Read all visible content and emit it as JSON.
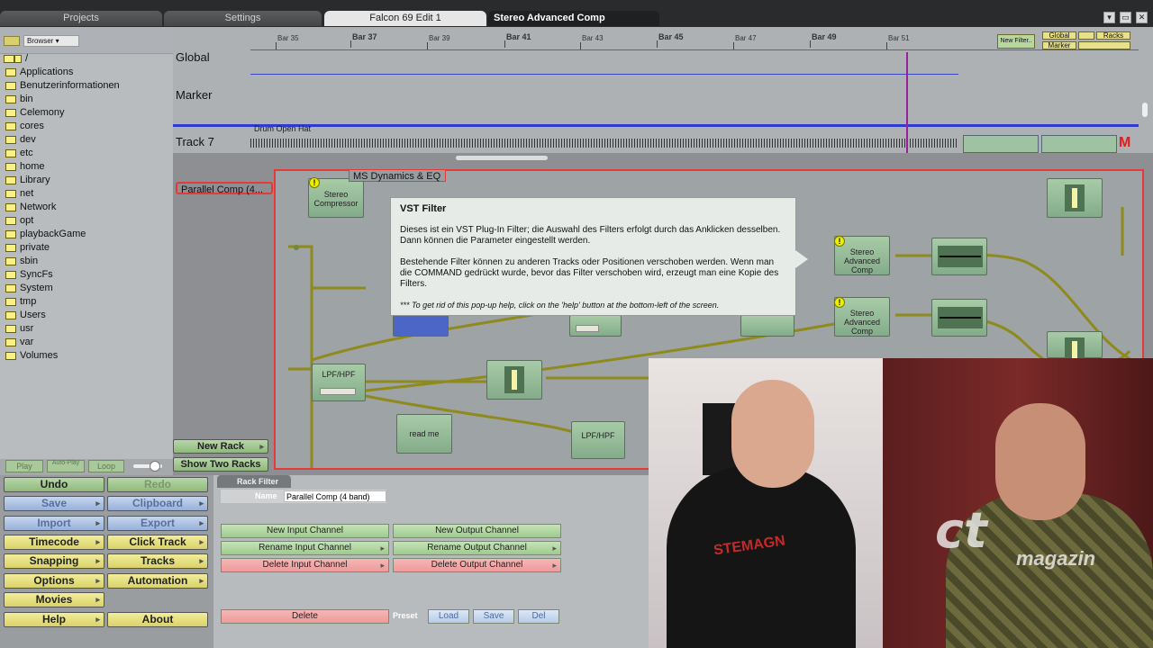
{
  "tabs": [
    {
      "label": "Projects"
    },
    {
      "label": "Settings"
    },
    {
      "label": "Falcon 69 Edit 1"
    },
    {
      "label": "Stereo Advanced Comp"
    }
  ],
  "browser": {
    "selector": "Browser",
    "path": "/",
    "items": [
      "Applications",
      "Benutzerinformationen",
      "bin",
      "Celemony",
      "cores",
      "dev",
      "etc",
      "home",
      "Library",
      "net",
      "Network",
      "opt",
      "playbackGame",
      "private",
      "sbin",
      "SyncFs",
      "System",
      "tmp",
      "Users",
      "usr",
      "var",
      "Volumes"
    ]
  },
  "transport": {
    "play": "Play",
    "autoplay": "Auto-Play",
    "loop": "Loop"
  },
  "timeline": {
    "ticks": [
      "Bar 35",
      "Bar 37",
      "Bar 39",
      "Bar 41",
      "Bar 43",
      "Bar 45",
      "Bar 47",
      "Bar 49",
      "Bar 51"
    ],
    "global": "Global",
    "marker": "Marker",
    "clip": "Drum Open Hat",
    "track": "Track 7",
    "new_filter": "New Filter..",
    "global_btn": "Global",
    "racks_btn": "Racks",
    "marker_btn": "Marker",
    "mute": "M"
  },
  "racks": {
    "list": [
      "MS Dynamics & EQ",
      "Parallel Comp (4..."
    ],
    "new_rack": "New Rack",
    "show_two": "Show Two Racks",
    "nodes": {
      "stereo_comp": "Stereo Compressor",
      "lpf1": "LPF/HPF",
      "lpf2": "LPF/HPF",
      "readme": "read me",
      "adv1": "Stereo Advanced Comp",
      "adv2": "Stereo Advanced Comp"
    }
  },
  "tooltip": {
    "title": "VST Filter",
    "p1": "Dieses ist ein VST Plug-In Filter; die Auswahl des Filters erfolgt durch das Anklicken desselben. Dann können die Parameter eingestellt werden.",
    "p2": "Bestehende Filter können zu anderen Tracks oder Positionen verschoben werden. Wenn man die COMMAND gedrückt wurde, bevor das Filter verschoben wird, erzeugt man eine Kopie des Filters.",
    "note": "*** To get rid of this pop-up help, click on the 'help' button at the bottom-left of the screen."
  },
  "buttons": {
    "undo": "Undo",
    "redo": "Redo",
    "save": "Save",
    "clipboard": "Clipboard",
    "import": "Import",
    "export": "Export",
    "timecode": "Timecode",
    "click_track": "Click Track",
    "snapping": "Snapping",
    "tracks": "Tracks",
    "options": "Options",
    "automation": "Automation",
    "movies": "Movies",
    "help": "Help",
    "about": "About"
  },
  "rack_filter": {
    "tab": "Rack Filter",
    "name_label": "Name",
    "name_value": "Parallel Comp (4 band)",
    "new_input": "New Input Channel",
    "new_output": "New Output Channel",
    "rename_input": "Rename Input Channel",
    "rename_output": "Rename Output Channel",
    "delete_input": "Delete Input Channel",
    "delete_output": "Delete Output Channel",
    "delete": "Delete",
    "preset": "Preset",
    "load": "Load",
    "save": "Save",
    "del": "Del"
  },
  "video": {
    "logo": "ct",
    "magazin": "magazin",
    "shirt": "STEMAGN"
  },
  "colors": {
    "rack_border": "#e43a3a",
    "cable": "#8e8a1c",
    "node": "#9fc2a0",
    "lane": "#3a4ac7"
  }
}
